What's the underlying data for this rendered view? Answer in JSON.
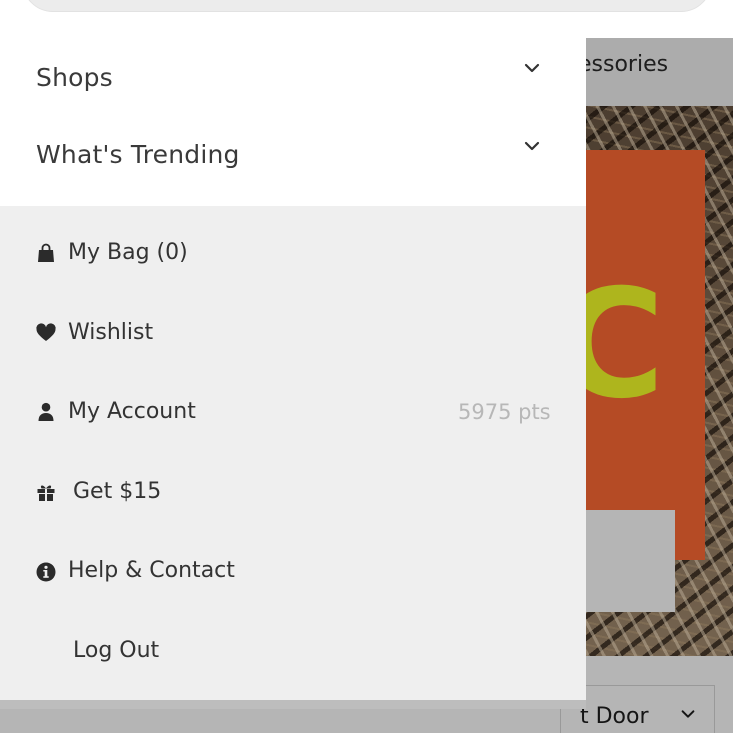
{
  "background": {
    "category_tab_label": "essories",
    "door_select_label": "t Door",
    "accent_color": "#ff6a35"
  },
  "drawer": {
    "accordions": [
      {
        "label": "Shops",
        "icon": "chevron-down-icon"
      },
      {
        "label": "What's Trending",
        "icon": "chevron-down-icon"
      }
    ],
    "menu": {
      "bag": {
        "label": "My Bag (0)",
        "icon": "shopping-bag-icon"
      },
      "wishlist": {
        "label": "Wishlist",
        "icon": "heart-icon"
      },
      "account": {
        "label": "My Account",
        "points": "5975 pts",
        "icon": "user-icon"
      },
      "referral": {
        "label": "Get $15",
        "icon": "gift-icon"
      },
      "help": {
        "label": "Help & Contact",
        "icon": "info-icon"
      },
      "logout": {
        "label": "Log Out"
      }
    }
  }
}
